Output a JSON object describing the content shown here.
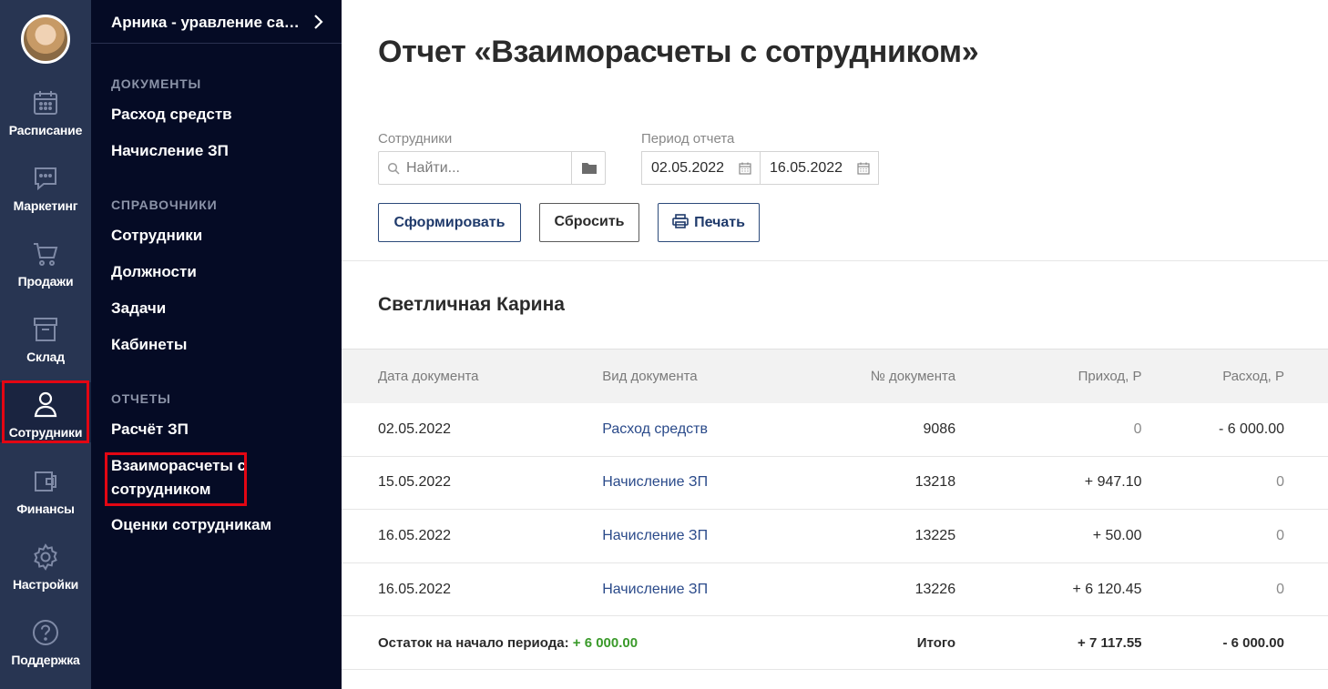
{
  "rail": {
    "items": [
      {
        "label": "Расписание",
        "icon": "calendar-icon"
      },
      {
        "label": "Маркетинг",
        "icon": "chat-icon"
      },
      {
        "label": "Продажи",
        "icon": "cart-icon"
      },
      {
        "label": "Склад",
        "icon": "box-icon"
      },
      {
        "label": "Сотрудники",
        "icon": "user-icon"
      },
      {
        "label": "Финансы",
        "icon": "wallet-icon"
      },
      {
        "label": "Настройки",
        "icon": "gear-icon"
      },
      {
        "label": "Поддержка",
        "icon": "help-icon"
      }
    ],
    "active_item": "Сотрудники",
    "highlight_color": "#e30613"
  },
  "menu": {
    "title": "Арника - уравление салоном",
    "sections": [
      {
        "title": "ДОКУМЕНТЫ",
        "links": [
          "Расход средств",
          "Начисление ЗП"
        ]
      },
      {
        "title": "СПРАВОЧНИКИ",
        "links": [
          "Сотрудники",
          "Должности",
          "Задачи",
          "Кабинеты"
        ]
      },
      {
        "title": "ОТЧЕТЫ",
        "links": [
          "Расчёт ЗП",
          "Взаиморасчеты с сотрудником",
          "Оценки сотрудникам"
        ]
      }
    ],
    "active_link": "Взаиморасчеты с сотрудником"
  },
  "page": {
    "title": "Отчет «Взаиморасчеты с сотрудником»"
  },
  "filters": {
    "employees_label": "Сотрудники",
    "search_placeholder": "Найти...",
    "period_label": "Период отчета",
    "date_from": "02.05.2022",
    "date_to": "16.05.2022"
  },
  "actions": {
    "generate": "Сформировать",
    "reset": "Сбросить",
    "print": "Печать"
  },
  "report": {
    "employee": "Светличная Карина",
    "columns": [
      "Дата документа",
      "Вид документа",
      "№ документа",
      "Приход, Р",
      "Расход, Р"
    ],
    "rows": [
      {
        "date": "02.05.2022",
        "type": "Расход средств",
        "number": "9086",
        "income": "0",
        "expense": "- 6 000.00"
      },
      {
        "date": "15.05.2022",
        "type": "Начисление ЗП",
        "number": "13218",
        "income": "+ 947.10",
        "expense": "0"
      },
      {
        "date": "16.05.2022",
        "type": "Начисление ЗП",
        "number": "13225",
        "income": "+ 50.00",
        "expense": "0"
      },
      {
        "date": "16.05.2022",
        "type": "Начисление ЗП",
        "number": "13226",
        "income": "+ 6 120.45",
        "expense": "0"
      }
    ],
    "footer": {
      "opening_label": "Остаток на начало периода:",
      "opening_value": "+ 6 000.00",
      "total_label": "Итого",
      "total_income": "+ 7 117.55",
      "total_expense": "- 6 000.00"
    }
  },
  "colors": {
    "rail_bg": "#283552",
    "menu_bg": "#050b25",
    "link": "#2a4a8a",
    "positive": "#3a9a2a"
  }
}
